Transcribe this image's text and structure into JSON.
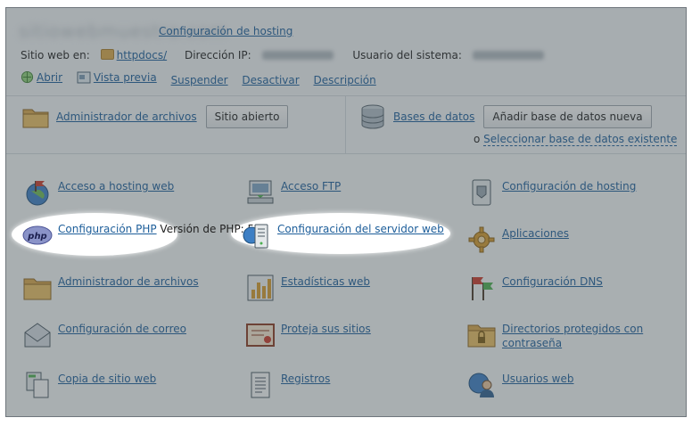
{
  "header": {
    "site_title": "sitiowebmuestra.com",
    "hosting_link": "Configuración de hosting",
    "website_label": "Sitio web en:",
    "website_folder": "httpdocs/",
    "ip_label": "Dirección IP:",
    "user_label": "Usuario del sistema:"
  },
  "actions": [
    {
      "label": "Abrir",
      "icon": "globe-icon"
    },
    {
      "label": "Vista previa",
      "icon": "preview-icon"
    },
    {
      "label": "Suspender"
    },
    {
      "label": "Desactivar"
    },
    {
      "label": "Descripción"
    }
  ],
  "panels": {
    "files": {
      "link": "Administrador de archivos",
      "button": "Sitio abierto"
    },
    "databases": {
      "link": "Bases de datos",
      "button": "Añadir base de datos nueva",
      "prefix": "o",
      "select_link": "Seleccionar base de datos existente"
    }
  },
  "grid": [
    {
      "label": "Acceso a hosting web",
      "icon": "globe-flag-icon"
    },
    {
      "label": "Acceso FTP",
      "icon": "ftp-icon"
    },
    {
      "label": "Configuración de hosting",
      "icon": "hosting-settings-icon"
    },
    {
      "label": "Configuración PHP",
      "sub": "Versión de PHP: 5.3",
      "icon": "php-icon",
      "highlight": true
    },
    {
      "label": "Configuración del servidor web",
      "icon": "web-server-icon",
      "highlight": true
    },
    {
      "label": "Aplicaciones",
      "icon": "gear-icon"
    },
    {
      "label": "Administrador de archivos",
      "icon": "folder-icon"
    },
    {
      "label": "Estadísticas web",
      "icon": "stats-icon"
    },
    {
      "label": "Configuración DNS",
      "icon": "dns-flags-icon"
    },
    {
      "label": "Configuración de correo",
      "icon": "mail-icon"
    },
    {
      "label": "Proteja sus sitios",
      "icon": "certificate-icon"
    },
    {
      "label": "Directorios protegidos con contraseña",
      "icon": "locked-folder-icon"
    },
    {
      "label": "Copia de sitio web",
      "icon": "copy-icon"
    },
    {
      "label": "Registros",
      "icon": "logs-icon"
    },
    {
      "label": "Usuarios web",
      "icon": "web-users-icon"
    }
  ]
}
